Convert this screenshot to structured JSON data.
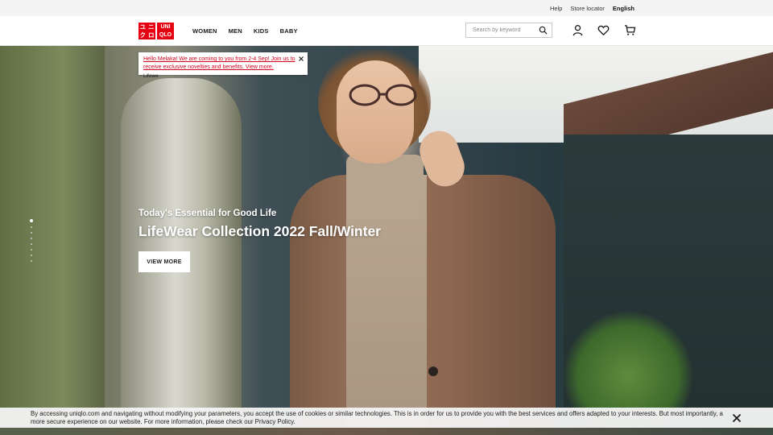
{
  "utility": {
    "help": "Help",
    "store_locator": "Store locator",
    "language": "English"
  },
  "logo": {
    "top_left": "ユ",
    "top_right": "ニ",
    "bottom_left": "ク",
    "bottom_right": "ロ",
    "word_top": "UNI",
    "word_bottom": "QLO"
  },
  "nav": {
    "items": [
      "WOMEN",
      "MEN",
      "KIDS",
      "BABY"
    ]
  },
  "search": {
    "placeholder": "Search by keyword"
  },
  "promo": {
    "message": "Hello Melaka! We are coming to you from 2-4 Sep! Join us to receive exclusive novelties and benefits. View more.",
    "label_below": "Lifewe"
  },
  "hero": {
    "subtitle": "Today's Essential for Good Life",
    "title": "LifeWear Collection 2022 Fall/Winter",
    "cta": "VIEW MORE",
    "slide_count": 8,
    "active_slide": 1
  },
  "cookie": {
    "text": "By accessing uniqlo.com and navigating without modifying your parameters, you accept the use of cookies or similar technologies. This is in order for us to provide you with the best services and offers adapted to your interests. But most importantly, a more secure experience on our website. For more information, please check our Privacy Policy."
  },
  "colors": {
    "brand_red": "#e60012",
    "promo_link": "#d0021b"
  }
}
